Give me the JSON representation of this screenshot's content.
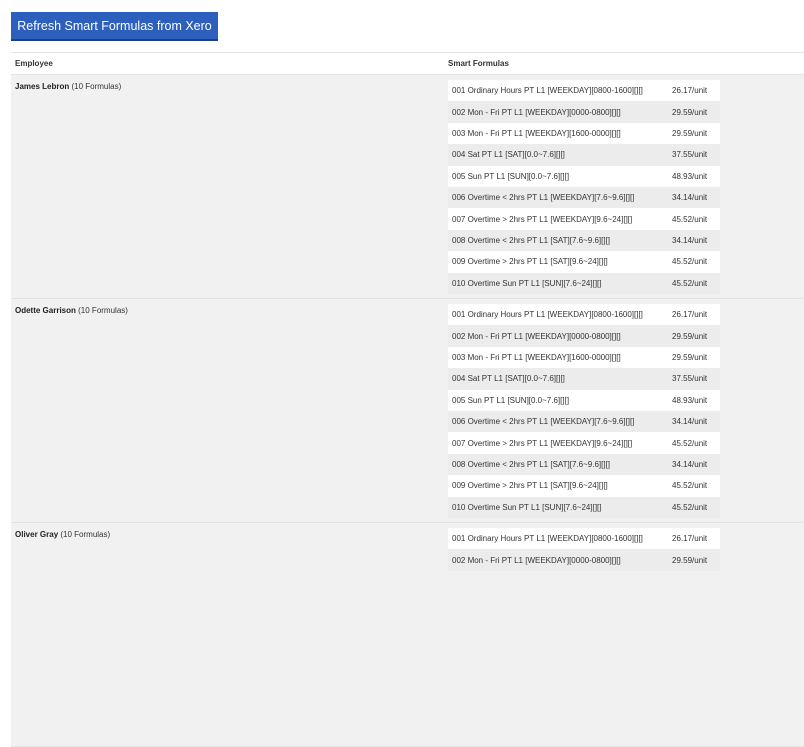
{
  "toolbar": {
    "refresh_label": "Refresh Smart Formulas from Xero"
  },
  "table": {
    "col_employee": "Employee",
    "col_smart_formulas": "Smart Formulas"
  },
  "employees": [
    {
      "name": "James Lebron",
      "count": "(10 Formulas)",
      "formulas": [
        {
          "name": "001 Ordinary Hours PT L1 [WEEKDAY][0800-1600][][]",
          "rate": "26.17/unit"
        },
        {
          "name": "002 Mon - Fri PT L1 [WEEKDAY][0000-0800][][]",
          "rate": "29.59/unit"
        },
        {
          "name": "003 Mon - Fri PT L1 [WEEKDAY][1600-0000][][]",
          "rate": "29.59/unit"
        },
        {
          "name": "004 Sat PT L1 [SAT][0.0~7.6][][]",
          "rate": "37.55/unit"
        },
        {
          "name": "005 Sun PT L1 [SUN][0.0~7.6][][]",
          "rate": "48.93/unit"
        },
        {
          "name": "006 Overtime < 2hrs PT L1 [WEEKDAY][7.6~9.6][][]",
          "rate": "34.14/unit"
        },
        {
          "name": "007 Overtime > 2hrs PT L1 [WEEKDAY][9.6~24][][]",
          "rate": "45.52/unit"
        },
        {
          "name": "008 Overtime < 2hrs PT L1 [SAT][7.6~9.6][][]",
          "rate": "34.14/unit"
        },
        {
          "name": "009 Overtime > 2hrs PT L1 [SAT][9.6~24][][]",
          "rate": "45.52/unit"
        },
        {
          "name": "010 Overtime Sun PT L1 [SUN][7.6~24][][]",
          "rate": "45.52/unit"
        }
      ]
    },
    {
      "name": "Odette Garrison",
      "count": "(10 Formulas)",
      "formulas": [
        {
          "name": "001 Ordinary Hours PT L1 [WEEKDAY][0800-1600][][]",
          "rate": "26.17/unit"
        },
        {
          "name": "002 Mon - Fri PT L1 [WEEKDAY][0000-0800][][]",
          "rate": "29.59/unit"
        },
        {
          "name": "003 Mon - Fri PT L1 [WEEKDAY][1600-0000][][]",
          "rate": "29.59/unit"
        },
        {
          "name": "004 Sat PT L1 [SAT][0.0~7.6][][]",
          "rate": "37.55/unit"
        },
        {
          "name": "005 Sun PT L1 [SUN][0.0~7.6][][]",
          "rate": "48.93/unit"
        },
        {
          "name": "006 Overtime < 2hrs PT L1 [WEEKDAY][7.6~9.6][][]",
          "rate": "34.14/unit"
        },
        {
          "name": "007 Overtime > 2hrs PT L1 [WEEKDAY][9.6~24][][]",
          "rate": "45.52/unit"
        },
        {
          "name": "008 Overtime < 2hrs PT L1 [SAT][7.6~9.6][][]",
          "rate": "34.14/unit"
        },
        {
          "name": "009 Overtime > 2hrs PT L1 [SAT][9.6~24][][]",
          "rate": "45.52/unit"
        },
        {
          "name": "010 Overtime Sun PT L1 [SUN][7.6~24][][]",
          "rate": "45.52/unit"
        }
      ]
    },
    {
      "name": "Oliver Gray",
      "count": "(10 Formulas)",
      "formulas": [
        {
          "name": "001 Ordinary Hours PT L1 [WEEKDAY][0800-1600][][]",
          "rate": "26.17/unit"
        },
        {
          "name": "002 Mon - Fri PT L1 [WEEKDAY][0000-0800][][]",
          "rate": "29.59/unit"
        }
      ]
    }
  ]
}
